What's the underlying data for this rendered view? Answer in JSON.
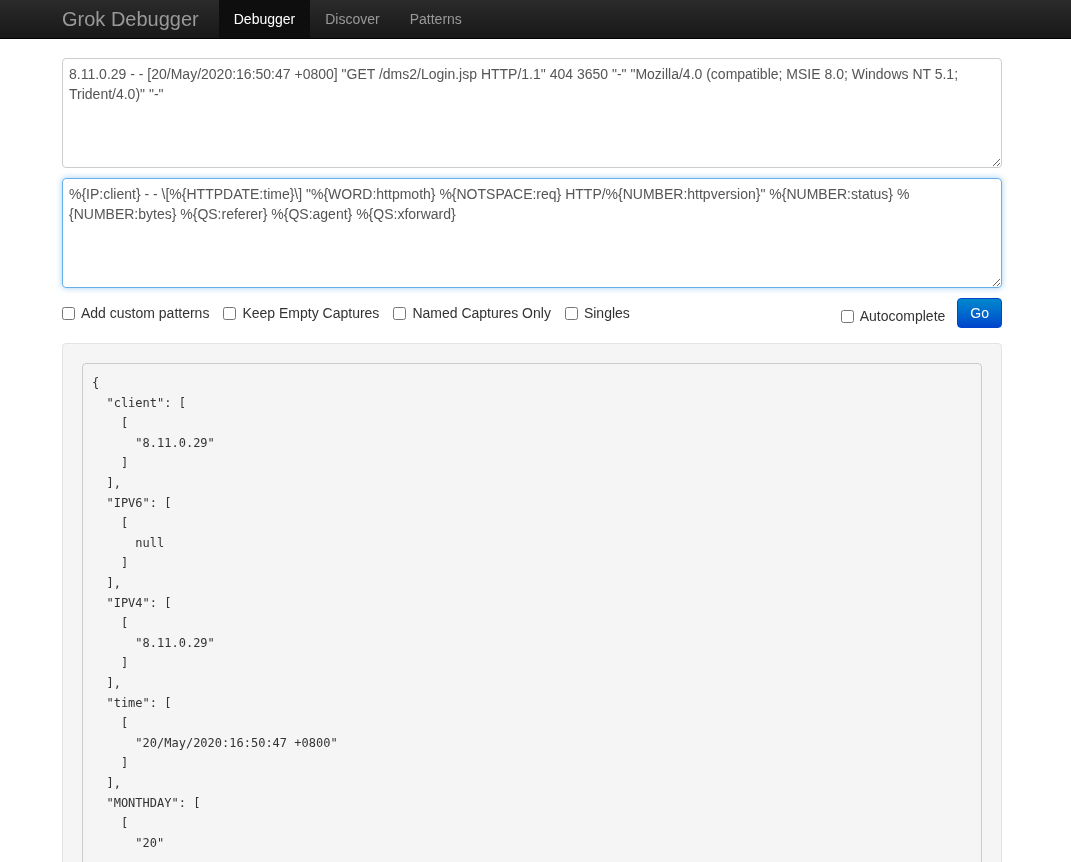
{
  "navbar": {
    "brand": "Grok Debugger",
    "tabs": [
      {
        "label": "Debugger",
        "selected": true
      },
      {
        "label": "Discover",
        "selected": false
      },
      {
        "label": "Patterns",
        "selected": false
      }
    ]
  },
  "input": {
    "value": "8.11.0.29 - - [20/May/2020:16:50:47 +0800] \"GET /dms2/Login.jsp HTTP/1.1\" 404 3650 \"-\" \"Mozilla/4.0 (compatible; MSIE 8.0; Windows NT 5.1; Trident/4.0)\" \"-\""
  },
  "pattern": {
    "value": "%{IP:client} - - \\[%{HTTPDATE:time}\\] \"%{WORD:httpmoth} %{NOTSPACE:req} HTTP/%{NUMBER:httpversion}\" %{NUMBER:status} %{NUMBER:bytes} %{QS:referer} %{QS:agent} %{QS:xforward}",
    "focused": true
  },
  "options": [
    {
      "label": "Add custom patterns",
      "checked": false
    },
    {
      "label": "Keep Empty Captures",
      "checked": false
    },
    {
      "label": "Named Captures Only",
      "checked": false
    },
    {
      "label": "Singles",
      "checked": false
    }
  ],
  "autocomplete": {
    "label": "Autocomplete",
    "checked": false
  },
  "go_button": "Go",
  "output": {
    "lines": [
      "{",
      "  \"client\": [",
      "    [",
      "      \"8.11.0.29\"",
      "    ]",
      "  ],",
      "  \"IPV6\": [",
      "    [",
      "      null",
      "    ]",
      "  ],",
      "  \"IPV4\": [",
      "    [",
      "      \"8.11.0.29\"",
      "    ]",
      "  ],",
      "  \"time\": [",
      "    [",
      "      \"20/May/2020:16:50:47 +0800\"",
      "    ]",
      "  ],",
      "  \"MONTHDAY\": [",
      "    [",
      "      \"20\""
    ]
  }
}
